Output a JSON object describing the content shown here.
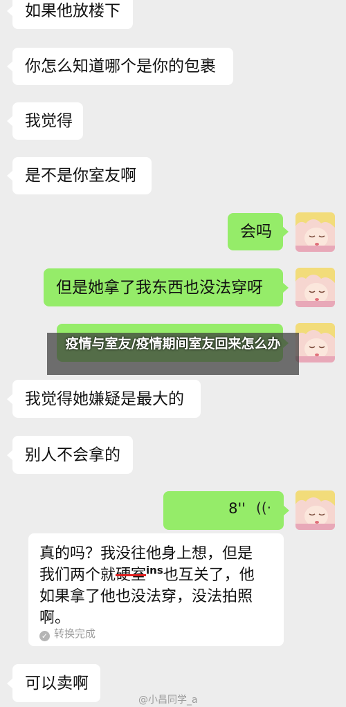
{
  "messages": [
    {
      "text": "如果他放楼下"
    },
    {
      "text": "你怎么知道哪个是你的包裹"
    },
    {
      "text": "我觉得"
    },
    {
      "text": "是不是你室友啊"
    },
    {
      "text": "会吗"
    },
    {
      "text": "但是她拿了我东西也没法穿呀"
    },
    {
      "text": "我觉得她嫌疑是最大的"
    },
    {
      "text": "别人不会拿的"
    },
    {
      "text": "可以卖啊"
    }
  ],
  "voice": {
    "duration": "8''",
    "wave_icon": "((·"
  },
  "transcript": {
    "line1": "真的吗？我没往他身上想，但是",
    "line2_a": "我们两个就",
    "line2_struck": "硬室",
    "line2_ins": "ins",
    "line2_b": "也互关了，他",
    "line3": "如果拿了他也没法穿，没法拍照",
    "line4": "啊。",
    "status": "转换完成"
  },
  "banner": {
    "title": "疫情与室友/疫情期间室友回来怎么办"
  },
  "watermark": {
    "text": "@小昌同学_a"
  },
  "colors": {
    "left_bubble": "#ffffff",
    "right_bubble": "#95ec69",
    "background": "#ededed"
  }
}
